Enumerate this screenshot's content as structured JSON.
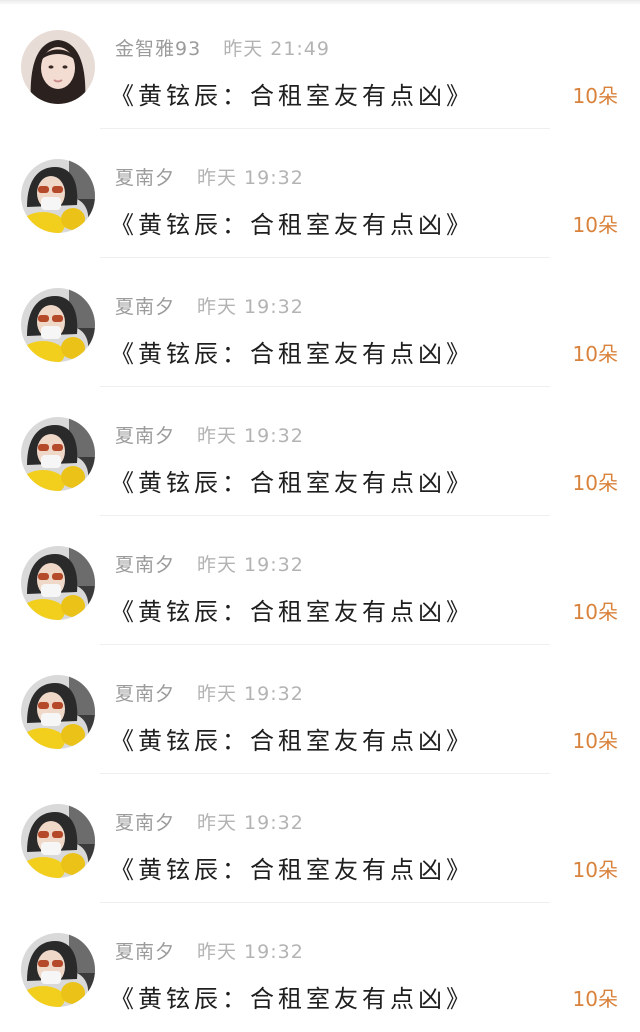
{
  "comments": [
    {
      "user": "金智雅93",
      "time": "昨天 21:49",
      "text": "《黄铉辰：合租室友有点凶》",
      "count": "10朵",
      "avatar": "long-hair-portrait"
    },
    {
      "user": "夏南夕",
      "time": "昨天 19:32",
      "text": "《黄铉辰：合租室友有点凶》",
      "count": "10朵",
      "avatar": "sunglasses-portrait"
    },
    {
      "user": "夏南夕",
      "time": "昨天 19:32",
      "text": "《黄铉辰：合租室友有点凶》",
      "count": "10朵",
      "avatar": "sunglasses-portrait"
    },
    {
      "user": "夏南夕",
      "time": "昨天 19:32",
      "text": "《黄铉辰：合租室友有点凶》",
      "count": "10朵",
      "avatar": "sunglasses-portrait"
    },
    {
      "user": "夏南夕",
      "time": "昨天 19:32",
      "text": "《黄铉辰：合租室友有点凶》",
      "count": "10朵",
      "avatar": "sunglasses-portrait"
    },
    {
      "user": "夏南夕",
      "time": "昨天 19:32",
      "text": "《黄铉辰：合租室友有点凶》",
      "count": "10朵",
      "avatar": "sunglasses-portrait"
    },
    {
      "user": "夏南夕",
      "time": "昨天 19:32",
      "text": "《黄铉辰：合租室友有点凶》",
      "count": "10朵",
      "avatar": "sunglasses-portrait"
    },
    {
      "user": "夏南夕",
      "time": "昨天 19:32",
      "text": "《黄铉辰：合租室友有点凶》",
      "count": "10朵",
      "avatar": "sunglasses-portrait"
    }
  ],
  "colors": {
    "count": "#d9823b",
    "name": "#9b9b9b",
    "message": "#1f1f1f",
    "divider": "#efefef"
  }
}
